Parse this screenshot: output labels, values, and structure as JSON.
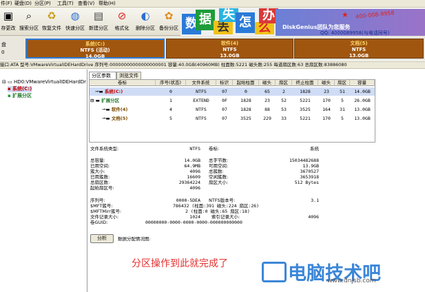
{
  "menubar": {
    "items": [
      "件(F)",
      "硬盘(D)",
      "分区(P)",
      "工具(T)",
      "查看(V)",
      "帮助(H)"
    ]
  },
  "toolbar": {
    "buttons": [
      {
        "label": "存更改",
        "icon": "save-icon"
      },
      {
        "label": "搜索分区",
        "icon": "search-icon"
      },
      {
        "label": "恢复文件",
        "icon": "recover-icon"
      },
      {
        "label": "快速分区",
        "icon": "quick-partition-icon"
      },
      {
        "label": "新建分区",
        "icon": "new-partition-icon"
      },
      {
        "label": "格式化",
        "icon": "format-icon"
      },
      {
        "label": "删除分区",
        "icon": "delete-icon"
      },
      {
        "label": "备份分区",
        "icon": "backup-icon"
      }
    ]
  },
  "banner": {
    "chars": [
      "数",
      "据",
      "丢",
      "失",
      "怎",
      "么",
      "办"
    ],
    "brand": "DiskGenius团队为您服务",
    "qq": "QQ: 4000089958(与电话同号)",
    "tel": "400-008-9958"
  },
  "disk": {
    "left_label": "盘",
    "left_index": "0",
    "segments": [
      {
        "name": "系统(C:)",
        "fs": "NTFS (活动)",
        "size": "14.0GB",
        "color": "#a0560f"
      },
      {
        "name": "软件(4)",
        "fs": "NTFS",
        "size": "13.0GB",
        "color": "#a0560f"
      },
      {
        "name": "文档(5)",
        "fs": "NTFS",
        "size": "13.0GB",
        "color": "#a0560f"
      }
    ]
  },
  "infobar": {
    "text": "接口:ATA  型号:VMwareVirtualIDEHardDrive  序列号:00000000000000000001  容量:40.0GB(40960MB)  柱面数:5221  磁头数:255  每道扇区数:63  总扇区数:83886080"
  },
  "tree": {
    "root": "HD0:VMwareVirtualIDEHardDr",
    "items": [
      "系统(C:)",
      "扩展分区"
    ]
  },
  "tabs": [
    "分区参数",
    "浏览文件"
  ],
  "table": {
    "columns": [
      "卷标",
      "序号(状态)",
      "文件系统",
      "标识",
      "起始柱面",
      "磁头",
      "扇区",
      "终止柱面",
      "磁头",
      "扇区",
      "容量"
    ],
    "rows": [
      {
        "cells": [
          "系统(C:)",
          "0",
          "NTFS",
          "07",
          "0",
          "65",
          "2",
          "1828",
          "23",
          "51",
          "14.0GB"
        ],
        "selected": true
      },
      {
        "cells": [
          "扩展分区",
          "1",
          "EXTEND",
          "0F",
          "1828",
          "23",
          "52",
          "5221",
          "170",
          "5",
          "26.0GB"
        ],
        "selected": false
      },
      {
        "cells": [
          "软件(4)",
          "4",
          "NTFS",
          "07",
          "1828",
          "88",
          "53",
          "3525",
          "164",
          "31",
          "13.0GB"
        ],
        "selected": false
      },
      {
        "cells": [
          "文档(5)",
          "5",
          "NTFS",
          "07",
          "3525",
          "229",
          "33",
          "5221",
          "170",
          "5",
          "13.0GB"
        ],
        "selected": false
      }
    ]
  },
  "details": {
    "fs_type_label": "文件系统类型:",
    "fs_type": "NTFS",
    "vol_label": "卷标:",
    "vol_value": "系统",
    "left": [
      [
        "总容量:",
        "14.0GB"
      ],
      [
        "已用空间:",
        "64.9MB"
      ],
      [
        "簇大小:",
        "4096"
      ],
      [
        "已用簇数:",
        "16609"
      ],
      [
        "总扇区数:",
        "29364224"
      ],
      [
        "起始扇区号:",
        "4096"
      ]
    ],
    "right": [
      [
        "总字节数:",
        "15034482688"
      ],
      [
        "可用空间:",
        "13.9GB"
      ],
      [
        "总簇数:",
        "3670527"
      ],
      [
        "空闲簇数:",
        "3653918"
      ],
      [
        "扇区大小:",
        "512 Bytes"
      ]
    ],
    "left2": [
      [
        "序列号:",
        "0000-5DEA"
      ],
      [
        "$MFT簇号:",
        "786432 (柱面:391 磁头:224 扇区:26)"
      ],
      [
        "$MFTMirr簇号:",
        "2 (柱面:0 磁头:65 扇区:18)"
      ],
      [
        "文件记录大小:",
        "1024"
      ],
      [
        "卷GUID:",
        "00000000-0000-0000-0000-000000000000"
      ]
    ],
    "right2": [
      [
        "NTFS版本号:",
        "3.1"
      ],
      [
        "索引记录大小:",
        "4096"
      ]
    ],
    "analyze_label": "分析",
    "alloc_label": "数据分配情况图:"
  },
  "overlay": {
    "text": "分区操作到此就完成了",
    "watermark": "电脑技术吧",
    "site": "www.dnjsb.com"
  }
}
